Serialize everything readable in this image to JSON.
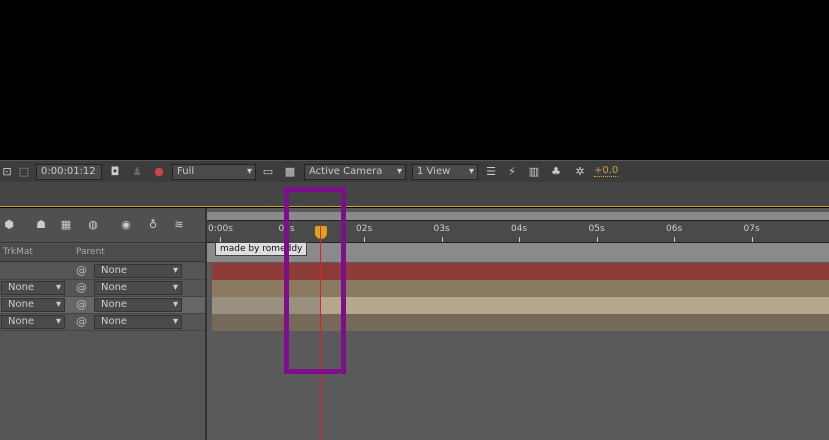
{
  "toolbar": {
    "timecode": "0:00:01:12",
    "resolution": "Full",
    "camera": "Active Camera",
    "views": "1 View",
    "exposure": "+0.0"
  },
  "columns": {
    "trkmat": "TrkMat",
    "parent": "Parent"
  },
  "layers": [
    {
      "trkmat": null,
      "parent": "None",
      "color": "#8e3b3b"
    },
    {
      "trkmat": "None",
      "parent": "None",
      "color": "#8a7a60"
    },
    {
      "trkmat": "None",
      "parent": "None",
      "color": "#b4a88c"
    },
    {
      "trkmat": "None",
      "parent": "None",
      "color": "#76695a"
    }
  ],
  "ruler": {
    "ticks": [
      "0:00s",
      "01s",
      "02s",
      "03s",
      "04s",
      "05s",
      "06s",
      "07s"
    ]
  },
  "tooltip": "made by romeddy",
  "current_time_seconds": 1.5
}
